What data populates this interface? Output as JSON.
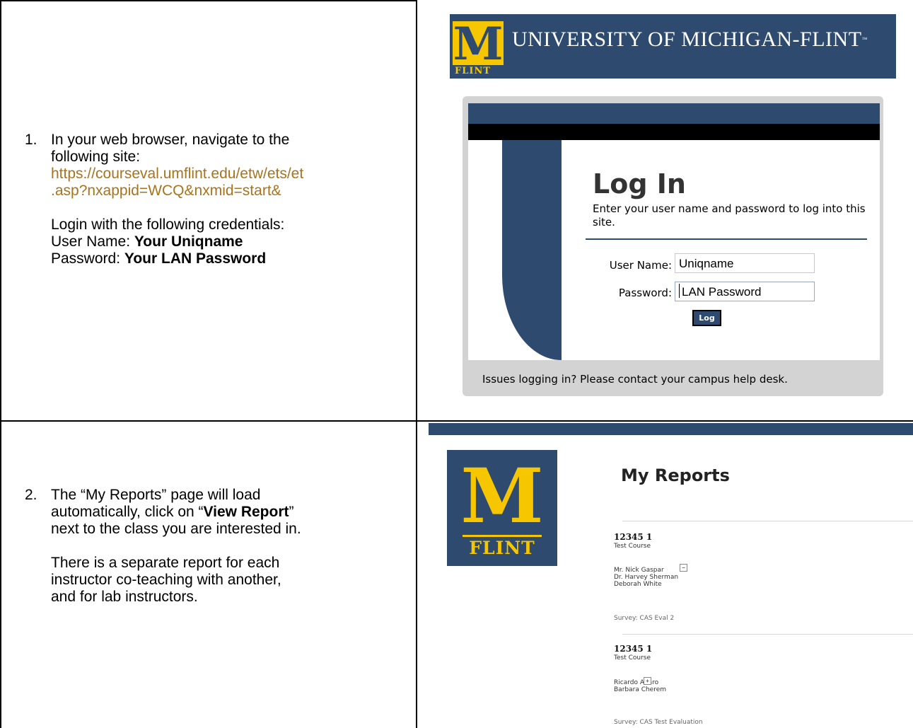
{
  "step1": {
    "number": "1.",
    "line1": "In your web browser, navigate to the",
    "line2": "following site:",
    "url_line1": "https://courseval.umflint.edu/etw/ets/et",
    "url_line2": ".asp?nxappid=WCQ&nxmid=start&",
    "login_intro": "Login with the following credentials:",
    "user_label": "User Name: ",
    "user_value": "Your Uniqname",
    "pass_label": "Password: ",
    "pass_value": "Your LAN Password"
  },
  "step2": {
    "number": "2.",
    "line1": "The “My Reports” page will load",
    "line2_prefix": "automatically, click on “",
    "line2_bold": "View Report",
    "line2_suffix": "”",
    "line3": "next to the class you are interested in.",
    "para2_line1": "There is a separate report for each",
    "para2_line2": "instructor co-teaching with another,",
    "para2_line3": "and for lab instructors."
  },
  "login_screenshot": {
    "logo_m": "M",
    "logo_flint": "FLINT",
    "university_name": "UNIVERSITY OF MICHIGAN-FLINT",
    "trademark": "™",
    "title": "Log In",
    "subtitle": "Enter your user name and password to log into this site.",
    "user_label": "User Name:",
    "user_value": "Uniqname",
    "pass_label": "Password:",
    "pass_value": "LAN Password",
    "button": "Log In",
    "help_text": "Issues logging in? Please contact your campus help desk.",
    "colors": {
      "navy": "#2e4a6e",
      "maize": "#f6c600"
    }
  },
  "reports_screenshot": {
    "logo_m": "M",
    "logo_flint": "FLINT",
    "title": "My Reports",
    "reports": [
      {
        "code": "12345 1",
        "course": "Test Course",
        "instructors": [
          "Mr. Nick Gaspar",
          "Dr. Harvey Sherman",
          "Deborah White"
        ],
        "toggle": "−",
        "survey": "Survey: CAS Eval 2"
      },
      {
        "code": "12345 1",
        "course": "Test Course",
        "instructors": [
          "Ricardo Alfaro",
          "Barbara Cherem"
        ],
        "toggle": "+",
        "survey": "Survey: CAS Test Evaluation"
      }
    ]
  }
}
